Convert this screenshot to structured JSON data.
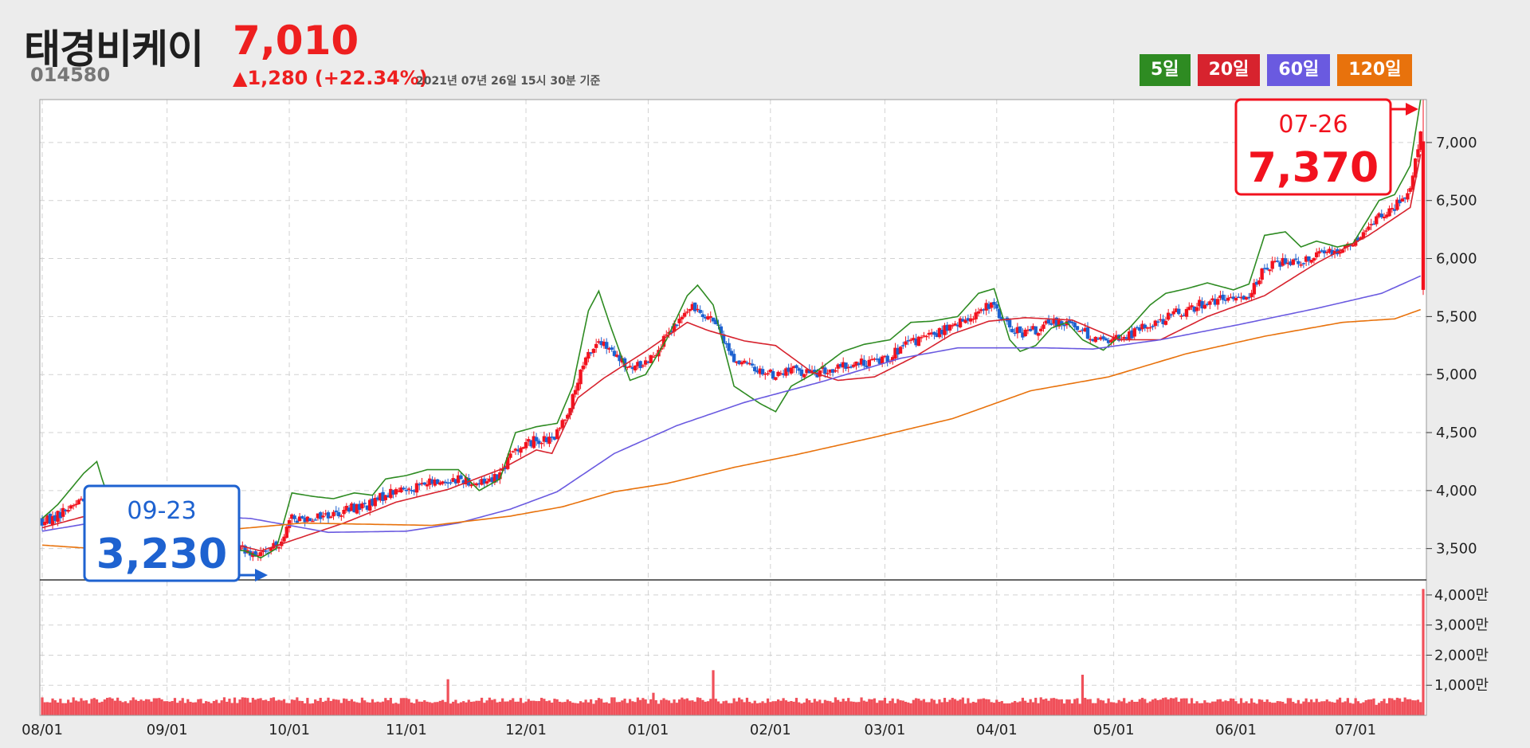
{
  "stock": {
    "name": "태경비케이",
    "code": "014580",
    "price": "7,010",
    "change": "▲1,280 (+22.34%)",
    "as_of": "2021년 07년 26일 15시 30분 기준"
  },
  "legend": [
    {
      "label": "5일",
      "color": "#2e8b22"
    },
    {
      "label": "20일",
      "color": "#d7232e"
    },
    {
      "label": "60일",
      "color": "#6a5ae0"
    },
    {
      "label": "120일",
      "color": "#e8720c"
    }
  ],
  "callouts": {
    "high": {
      "date": "07-26",
      "value": "7,370"
    },
    "low": {
      "date": "09-23",
      "value": "3,230"
    }
  },
  "colors": {
    "up": "#f2121e",
    "down": "#1e62d0",
    "volume": "#f0505a"
  },
  "chart_data": [
    {
      "type": "candlestick",
      "x_ticks": [
        "08/01",
        "09/01",
        "10/01",
        "11/01",
        "12/01",
        "01/01",
        "02/01",
        "03/01",
        "04/01",
        "05/01",
        "06/01",
        "07/01"
      ],
      "y_ticks": [
        "3,500",
        "4,000",
        "4,500",
        "5,000",
        "5,500",
        "6,000",
        "6,500",
        "7,000"
      ],
      "ylim": [
        3230,
        7370
      ],
      "grid": true,
      "ma_keyframes": {
        "ma5": [
          [
            0,
            3760
          ],
          [
            6,
            3880
          ],
          [
            16,
            4150
          ],
          [
            21,
            4250
          ],
          [
            23,
            4100
          ],
          [
            28,
            3780
          ],
          [
            38,
            3880
          ],
          [
            42,
            3700
          ],
          [
            48,
            3300
          ],
          [
            51,
            3260
          ],
          [
            57,
            3600
          ],
          [
            61,
            3870
          ],
          [
            65,
            3600
          ],
          [
            70,
            3500
          ],
          [
            78,
            3480
          ],
          [
            84,
            3420
          ],
          [
            90,
            3500
          ],
          [
            96,
            3980
          ],
          [
            104,
            3950
          ],
          [
            112,
            3930
          ],
          [
            120,
            3980
          ],
          [
            127,
            3960
          ],
          [
            132,
            4100
          ],
          [
            140,
            4130
          ],
          [
            148,
            4180
          ],
          [
            160,
            4180
          ],
          [
            168,
            4000
          ],
          [
            176,
            4100
          ],
          [
            182,
            4500
          ],
          [
            190,
            4550
          ],
          [
            198,
            4580
          ],
          [
            204,
            4900
          ],
          [
            210,
            5550
          ],
          [
            214,
            5720
          ],
          [
            218,
            5450
          ],
          [
            226,
            4950
          ],
          [
            232,
            5000
          ],
          [
            240,
            5300
          ],
          [
            248,
            5680
          ],
          [
            252,
            5770
          ],
          [
            258,
            5600
          ],
          [
            266,
            4900
          ],
          [
            276,
            4750
          ],
          [
            282,
            4680
          ],
          [
            288,
            4900
          ],
          [
            296,
            5000
          ],
          [
            308,
            5200
          ],
          [
            316,
            5260
          ],
          [
            326,
            5300
          ],
          [
            334,
            5450
          ],
          [
            342,
            5460
          ],
          [
            352,
            5500
          ],
          [
            360,
            5700
          ],
          [
            366,
            5740
          ],
          [
            372,
            5300
          ],
          [
            376,
            5200
          ],
          [
            382,
            5250
          ],
          [
            388,
            5400
          ],
          [
            394,
            5450
          ],
          [
            400,
            5300
          ],
          [
            408,
            5210
          ],
          [
            418,
            5400
          ],
          [
            426,
            5600
          ],
          [
            432,
            5700
          ],
          [
            440,
            5740
          ],
          [
            448,
            5790
          ],
          [
            458,
            5730
          ],
          [
            464,
            5780
          ],
          [
            470,
            6200
          ],
          [
            478,
            6230
          ],
          [
            484,
            6100
          ],
          [
            490,
            6150
          ],
          [
            498,
            6100
          ],
          [
            504,
            6130
          ],
          [
            510,
            6350
          ],
          [
            514,
            6500
          ],
          [
            520,
            6550
          ],
          [
            526,
            6800
          ],
          [
            530,
            7370
          ]
        ],
        "ma20": [
          [
            0,
            3680
          ],
          [
            20,
            3800
          ],
          [
            40,
            3760
          ],
          [
            52,
            3580
          ],
          [
            60,
            3660
          ],
          [
            70,
            3560
          ],
          [
            84,
            3480
          ],
          [
            100,
            3600
          ],
          [
            116,
            3720
          ],
          [
            136,
            3900
          ],
          [
            156,
            4010
          ],
          [
            176,
            4180
          ],
          [
            190,
            4350
          ],
          [
            196,
            4320
          ],
          [
            206,
            4800
          ],
          [
            216,
            4970
          ],
          [
            232,
            5200
          ],
          [
            248,
            5450
          ],
          [
            256,
            5380
          ],
          [
            270,
            5290
          ],
          [
            282,
            5250
          ],
          [
            296,
            5020
          ],
          [
            306,
            4950
          ],
          [
            320,
            4980
          ],
          [
            336,
            5160
          ],
          [
            350,
            5350
          ],
          [
            364,
            5460
          ],
          [
            378,
            5490
          ],
          [
            396,
            5470
          ],
          [
            414,
            5300
          ],
          [
            430,
            5300
          ],
          [
            448,
            5500
          ],
          [
            470,
            5680
          ],
          [
            490,
            5960
          ],
          [
            510,
            6200
          ],
          [
            526,
            6440
          ],
          [
            530,
            6900
          ]
        ],
        "ma60": [
          [
            0,
            3650
          ],
          [
            40,
            3800
          ],
          [
            80,
            3760
          ],
          [
            110,
            3640
          ],
          [
            140,
            3650
          ],
          [
            160,
            3720
          ],
          [
            180,
            3840
          ],
          [
            198,
            3990
          ],
          [
            220,
            4320
          ],
          [
            244,
            4560
          ],
          [
            270,
            4760
          ],
          [
            300,
            4940
          ],
          [
            330,
            5140
          ],
          [
            352,
            5230
          ],
          [
            366,
            5230
          ],
          [
            386,
            5230
          ],
          [
            404,
            5220
          ],
          [
            430,
            5300
          ],
          [
            460,
            5430
          ],
          [
            490,
            5570
          ],
          [
            515,
            5700
          ],
          [
            530,
            5850
          ]
        ],
        "ma120": [
          [
            0,
            3530
          ],
          [
            20,
            3500
          ],
          [
            60,
            3640
          ],
          [
            100,
            3720
          ],
          [
            150,
            3700
          ],
          [
            180,
            3780
          ],
          [
            200,
            3860
          ],
          [
            220,
            3990
          ],
          [
            240,
            4060
          ],
          [
            266,
            4200
          ],
          [
            290,
            4310
          ],
          [
            320,
            4460
          ],
          [
            350,
            4620
          ],
          [
            380,
            4860
          ],
          [
            410,
            4980
          ],
          [
            440,
            5180
          ],
          [
            470,
            5330
          ],
          [
            500,
            5450
          ],
          [
            520,
            5480
          ],
          [
            530,
            5560
          ]
        ]
      }
    },
    {
      "type": "bar",
      "name": "volume",
      "y_ticks": [
        "1,000만",
        "2,000만",
        "3,000만",
        "4,000만"
      ],
      "ylim": [
        0,
        45000000
      ],
      "spikes": [
        [
          156,
          12000000
        ],
        [
          235,
          7500000
        ],
        [
          258,
          15000000
        ],
        [
          400,
          13500000
        ],
        [
          477,
          4500000
        ],
        [
          513,
          3500000
        ],
        [
          531,
          42000000
        ]
      ],
      "base_volume": 4800000
    }
  ]
}
